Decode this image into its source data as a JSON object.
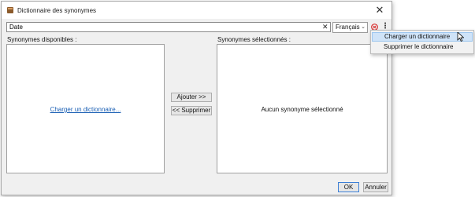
{
  "window": {
    "title": "Dictionnaire des synonymes",
    "close_glyph": "✕",
    "icon": "book-icon"
  },
  "search": {
    "value": "Date",
    "clear_glyph": "✕"
  },
  "language": {
    "selected": "Français",
    "chevron": "⌄"
  },
  "toolbar": {
    "remove_icon": "remove-circle-icon",
    "more_glyph": "⋮"
  },
  "left_panel": {
    "label": "Synonymes disponibles :",
    "load_link": "Charger un dictionnaire..."
  },
  "right_panel": {
    "label": "Synonymes sélectionnés :",
    "empty_text": "Aucun synonyme sélectionné"
  },
  "buttons": {
    "add": "Ajouter >>",
    "remove": "<< Supprimer",
    "ok": "OK",
    "cancel": "Annuler"
  },
  "menu": {
    "items": [
      {
        "label": "Charger un dictionnaire",
        "state": "hover"
      },
      {
        "label": "Supprimer le dictionnaire",
        "state": "normal"
      }
    ]
  },
  "colors": {
    "link": "#1a5fb4",
    "menu_hover": "#cfe3f8",
    "remove_icon": "#d62828"
  }
}
